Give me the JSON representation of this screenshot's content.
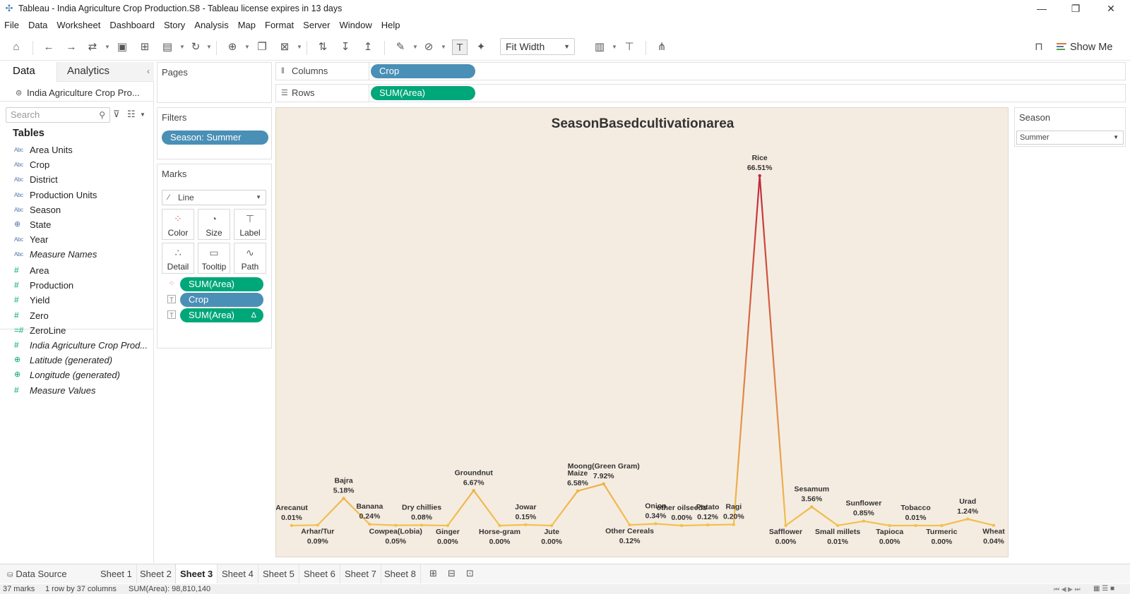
{
  "window": {
    "title": "Tableau - India Agriculture Crop Production.S8 - Tableau license expires in 13 days",
    "minimize": "—",
    "restore": "❐",
    "close": "✕"
  },
  "menu": [
    "File",
    "Data",
    "Worksheet",
    "Dashboard",
    "Story",
    "Analysis",
    "Map",
    "Format",
    "Server",
    "Window",
    "Help"
  ],
  "toolbar": {
    "fit": "Fit Width",
    "show_me": "Show Me"
  },
  "data_pane": {
    "tab_data": "Data",
    "tab_analytics": "Analytics",
    "datasource": "India Agriculture Crop Pro...",
    "search_placeholder": "Search",
    "tables_heading": "Tables",
    "dimensions": [
      {
        "icon": "Abc",
        "name": "Area Units"
      },
      {
        "icon": "Abc",
        "name": "Crop"
      },
      {
        "icon": "Abc",
        "name": "District"
      },
      {
        "icon": "Abc",
        "name": "Production Units"
      },
      {
        "icon": "Abc",
        "name": "Season"
      },
      {
        "icon": "⊕",
        "name": "State"
      },
      {
        "icon": "Abc",
        "name": "Year"
      },
      {
        "icon": "Abc",
        "name": "Measure Names"
      }
    ],
    "measures": [
      {
        "icon": "#",
        "name": "Area"
      },
      {
        "icon": "#",
        "name": "Production"
      },
      {
        "icon": "#",
        "name": "Yield"
      },
      {
        "icon": "#",
        "name": "Zero"
      },
      {
        "icon": "=#",
        "name": "ZeroLine"
      },
      {
        "icon": "#",
        "name": "India Agriculture Crop Prod..."
      },
      {
        "icon": "⊕",
        "name": "Latitude (generated)"
      },
      {
        "icon": "⊕",
        "name": "Longitude (generated)"
      },
      {
        "icon": "#",
        "name": "Measure Values"
      }
    ]
  },
  "pages_card": {
    "title": "Pages"
  },
  "filters_card": {
    "title": "Filters",
    "pill": "Season: Summer"
  },
  "marks_card": {
    "title": "Marks",
    "type": "Line",
    "buttons": [
      "Color",
      "Size",
      "Label",
      "Detail",
      "Tooltip",
      "Path"
    ],
    "pills": [
      {
        "label": "SUM(Area)",
        "kind": "mea",
        "icon": "color"
      },
      {
        "label": "Crop",
        "kind": "dim",
        "icon": "T"
      },
      {
        "label": "SUM(Area)",
        "kind": "mea",
        "icon": "T",
        "suffix": "Δ"
      }
    ]
  },
  "shelves": {
    "columns_label": "Columns",
    "columns_pill": "Crop",
    "rows_label": "Rows",
    "rows_pill": "SUM(Area)"
  },
  "season_filter": {
    "title": "Season",
    "value": "Summer"
  },
  "chart_data": {
    "type": "line",
    "title": "SeasonBasedcultivationarea",
    "value_label_suffix": "%",
    "categories": [
      "Arecanut",
      "Arhar/Tur",
      "Bajra",
      "Banana",
      "Cowpea(Lobia)",
      "Dry chillies",
      "Ginger",
      "Groundnut",
      "Horse-gram",
      "Jowar",
      "Jute",
      "Maize",
      "Moong(Green Gram)",
      "Other Cereals",
      "Onion",
      "other oilseeds",
      "Potato",
      "Ragi",
      "Rice",
      "Safflower",
      "Sesamum",
      "Small millets",
      "Sunflower",
      "Tapioca",
      "Tobacco",
      "Turmeric",
      "Urad",
      "Wheat"
    ],
    "values": [
      0.01,
      0.09,
      5.18,
      0.24,
      0.05,
      0.08,
      0.0,
      6.67,
      0.0,
      0.15,
      0.0,
      6.58,
      7.92,
      0.12,
      0.34,
      0.0,
      0.12,
      0.2,
      66.51,
      0.0,
      3.56,
      0.01,
      0.85,
      0.0,
      0.01,
      0.0,
      1.24,
      0.04
    ],
    "label_position": [
      "above",
      "below",
      "above",
      "above",
      "below",
      "above",
      "below",
      "above",
      "below",
      "above",
      "below",
      "above",
      "above",
      "below",
      "above",
      "above",
      "above",
      "above",
      "above",
      "below",
      "above",
      "below",
      "above",
      "below",
      "above",
      "below",
      "above",
      "below"
    ],
    "color_low": "#f2c14e",
    "color_high": "#c0283c",
    "ylim": [
      0,
      70
    ]
  },
  "sheet_tabs": {
    "data_source": "Data Source",
    "sheets": [
      "Sheet 1",
      "Sheet 2",
      "Sheet 3",
      "Sheet 4",
      "Sheet 5",
      "Sheet 6",
      "Sheet 7",
      "Sheet 8"
    ],
    "active": "Sheet 3"
  },
  "status": {
    "marks": "37 marks",
    "dims": "1 row by 37 columns",
    "sum": "SUM(Area): 98,810,140"
  }
}
